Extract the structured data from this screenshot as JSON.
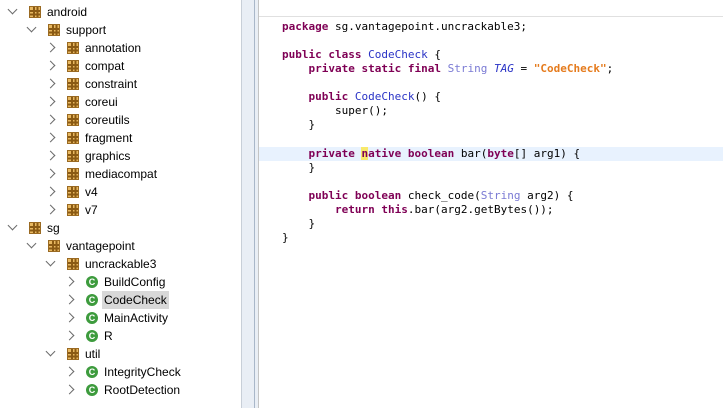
{
  "tree": [
    {
      "label": "android",
      "level": 0,
      "expanded": true,
      "icon": "package-icon"
    },
    {
      "label": "support",
      "level": 1,
      "expanded": true,
      "icon": "package-icon"
    },
    {
      "label": "annotation",
      "level": 2,
      "expanded": false,
      "icon": "package-icon"
    },
    {
      "label": "compat",
      "level": 2,
      "expanded": false,
      "icon": "package-icon"
    },
    {
      "label": "constraint",
      "level": 2,
      "expanded": false,
      "icon": "package-icon"
    },
    {
      "label": "coreui",
      "level": 2,
      "expanded": false,
      "icon": "package-icon"
    },
    {
      "label": "coreutils",
      "level": 2,
      "expanded": false,
      "icon": "package-icon"
    },
    {
      "label": "fragment",
      "level": 2,
      "expanded": false,
      "icon": "package-icon"
    },
    {
      "label": "graphics",
      "level": 2,
      "expanded": false,
      "icon": "package-icon"
    },
    {
      "label": "mediacompat",
      "level": 2,
      "expanded": false,
      "icon": "package-icon"
    },
    {
      "label": "v4",
      "level": 2,
      "expanded": false,
      "icon": "package-icon"
    },
    {
      "label": "v7",
      "level": 2,
      "expanded": false,
      "icon": "package-icon"
    },
    {
      "label": "sg",
      "level": 0,
      "expanded": true,
      "icon": "package-icon"
    },
    {
      "label": "vantagepoint",
      "level": 1,
      "expanded": true,
      "icon": "package-icon"
    },
    {
      "label": "uncrackable3",
      "level": 2,
      "expanded": true,
      "icon": "package-icon"
    },
    {
      "label": "BuildConfig",
      "level": 3,
      "expanded": false,
      "icon": "class-icon"
    },
    {
      "label": "CodeCheck",
      "level": 3,
      "expanded": false,
      "icon": "class-icon",
      "selected": true
    },
    {
      "label": "MainActivity",
      "level": 3,
      "expanded": false,
      "icon": "class-icon"
    },
    {
      "label": "R",
      "level": 3,
      "expanded": false,
      "icon": "class-icon"
    },
    {
      "label": "util",
      "level": 2,
      "expanded": true,
      "icon": "package-icon"
    },
    {
      "label": "IntegrityCheck",
      "level": 3,
      "expanded": false,
      "icon": "class-icon"
    },
    {
      "label": "RootDetection",
      "level": 3,
      "expanded": false,
      "icon": "class-icon"
    }
  ],
  "class_icon_letter": "C",
  "code": {
    "package_kw": "package",
    "package_name": " sg.vantagepoint.uncrackable3;",
    "public": "public",
    "class": "class",
    "class_name": "CodeCheck",
    "brace_open": " {",
    "private": "private",
    "static": "static",
    "final": "final",
    "string_type": "String",
    "tag_field": "TAG",
    "equals": " = ",
    "tag_value": "\"CodeCheck\"",
    "semicolon": ";",
    "ctor_name": "CodeCheck",
    "ctor_parens": "() {",
    "super_call": "super();",
    "close_brace": "}",
    "native_n": "n",
    "native_rest": "ative",
    "boolean": "boolean",
    "bar_sig": " bar(",
    "byte": "byte",
    "bar_args": "[] arg1) {",
    "check_sig": " check_code(",
    "arg2": " arg2) {",
    "return": "return",
    "this": "this",
    "return_rest": ".bar(arg2.getBytes());"
  }
}
